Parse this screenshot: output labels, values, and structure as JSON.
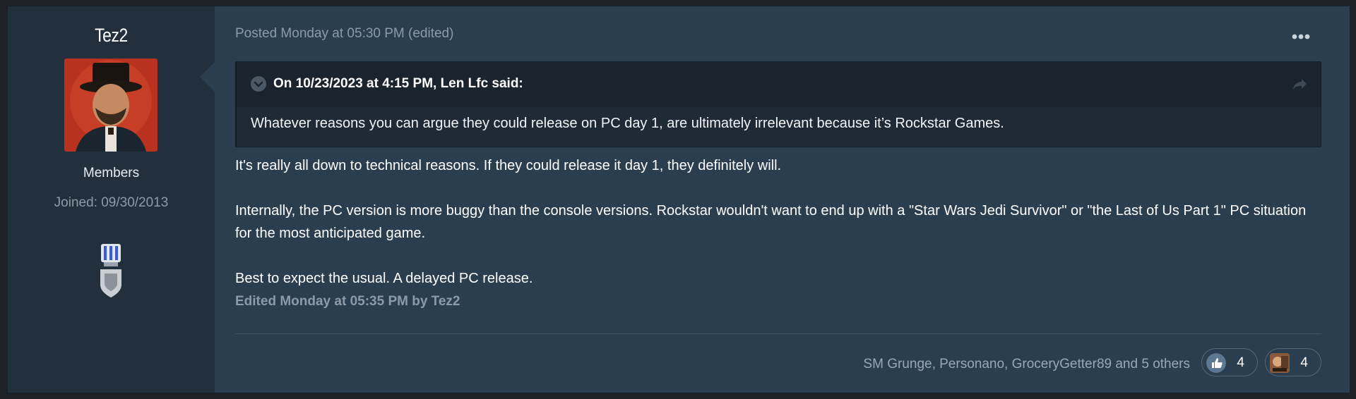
{
  "author": {
    "name": "Tez2",
    "group": "Members",
    "joined": "Joined: 09/30/2013"
  },
  "post": {
    "meta": "Posted Monday at 05:30 PM (edited)",
    "quote": {
      "citation": "On 10/23/2023 at 4:15 PM, Len Lfc said:",
      "text": "Whatever reasons you can argue they could release on PC day 1, are ultimately irrelevant because it’s Rockstar Games."
    },
    "paragraphs": [
      "It's really all down to technical reasons. If they could release it day 1, they definitely will.",
      "Internally, the PC version is more buggy than the console versions. Rockstar wouldn't want to end up with a \"Star Wars Jedi Survivor\" or \"the Last of Us Part 1\" PC situation for the most anticipated game.",
      "Best to expect the usual. A delayed PC release."
    ],
    "edited": "Edited Monday at 05:35 PM by Tez2"
  },
  "reactions": {
    "likers": "SM Grunge, Personano, GroceryGetter89 and 5 others",
    "items": [
      {
        "icon": "thumbs-up-icon",
        "count": "4"
      },
      {
        "icon": "custom-reaction-icon",
        "count": "4"
      }
    ]
  }
}
